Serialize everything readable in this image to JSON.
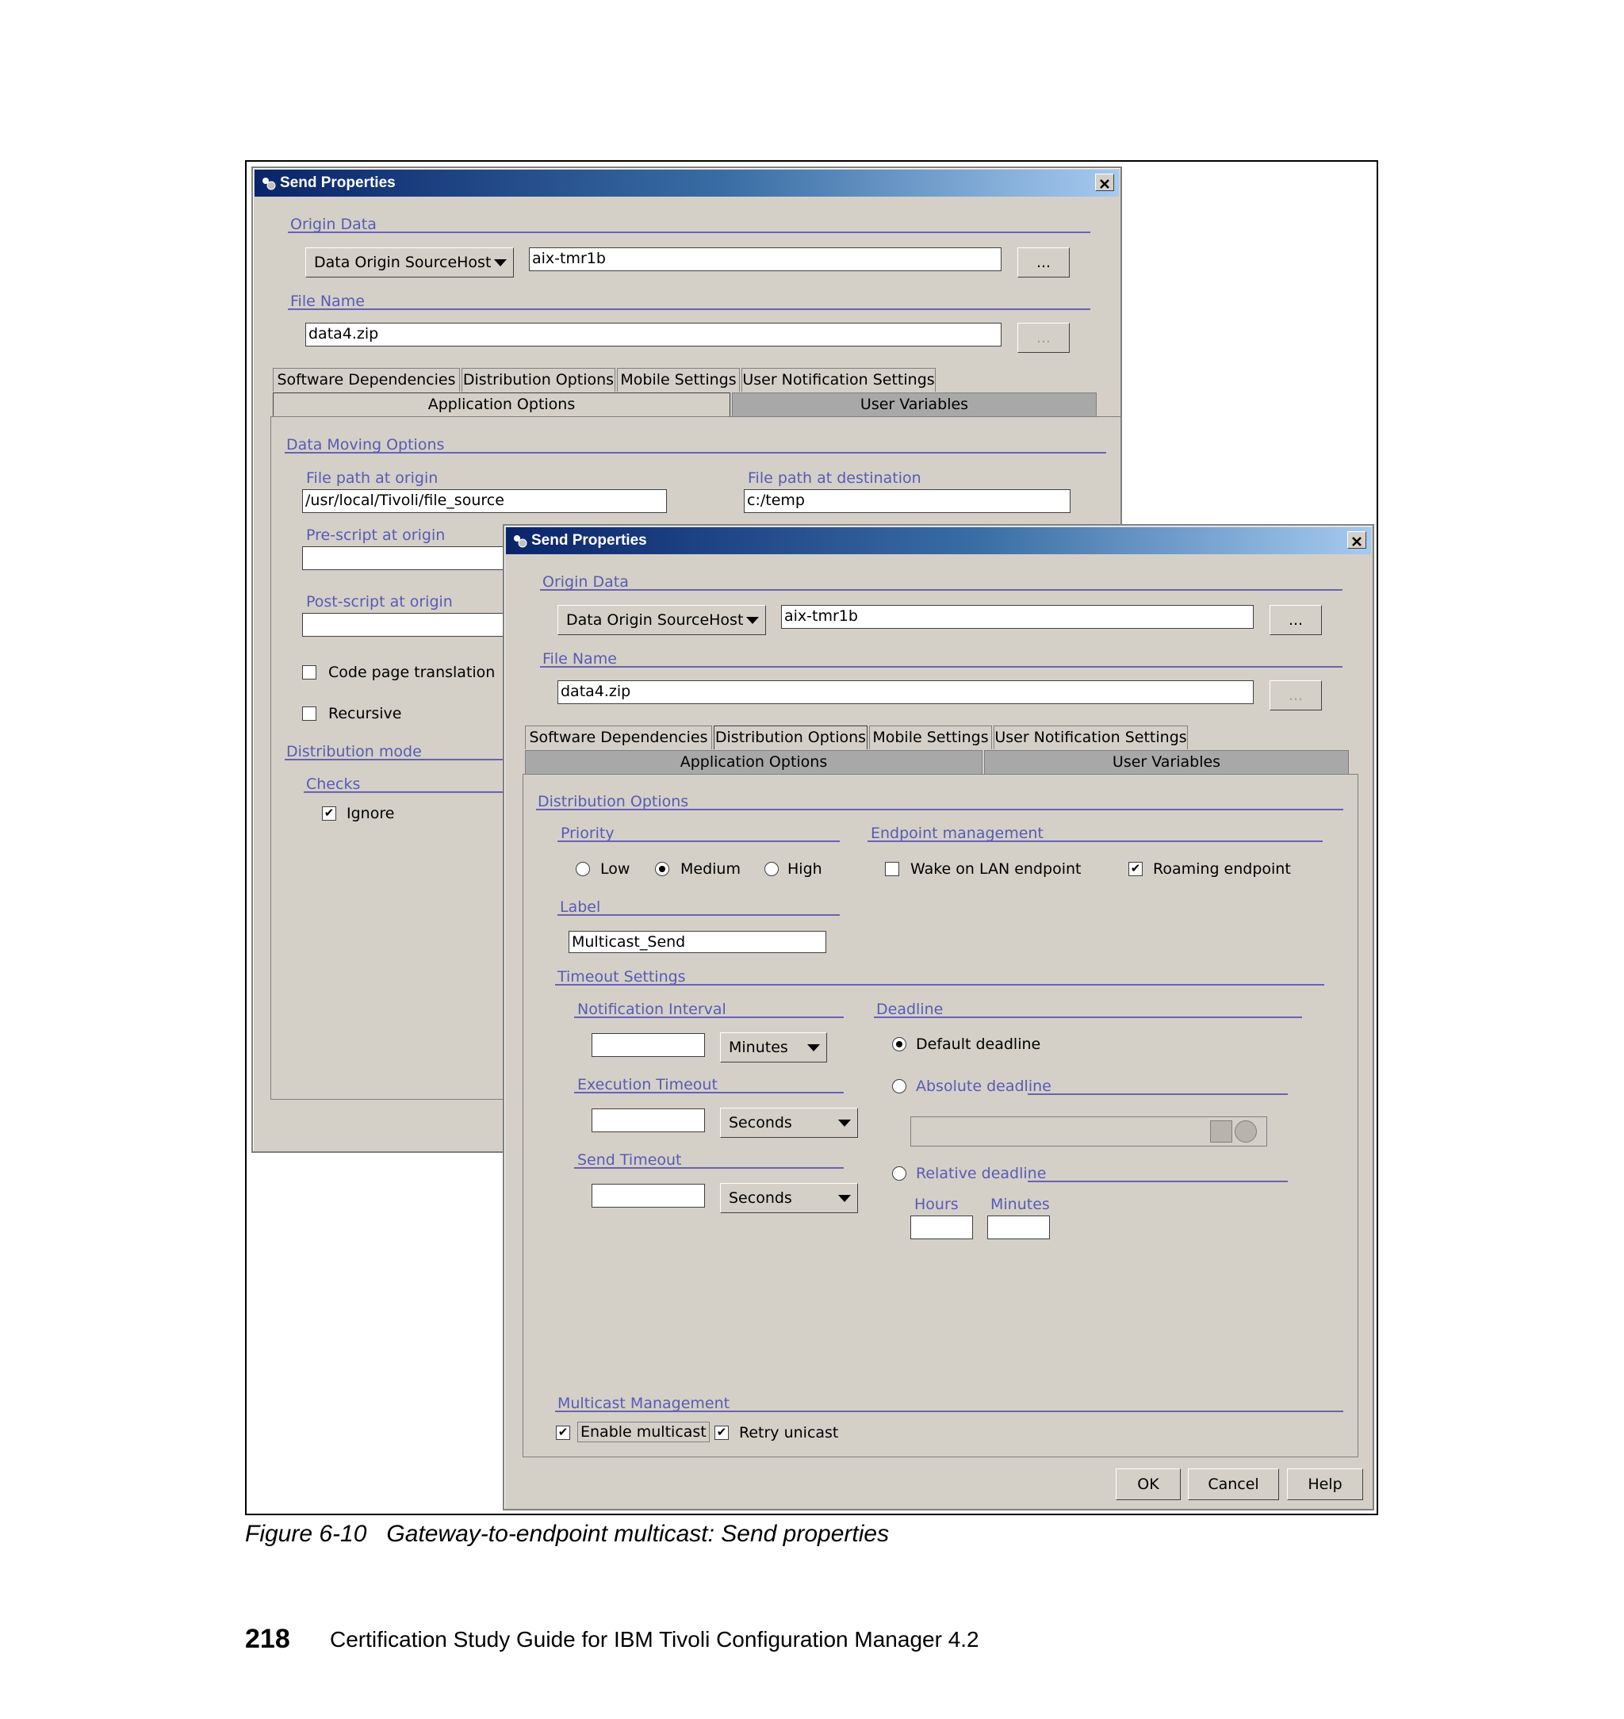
{
  "back_window": {
    "title": "Send Properties",
    "origin_data_label": "Origin Data",
    "origin_combo": "Data Origin SourceHost",
    "origin_value": "aix-tmr1b",
    "browse_label": "...",
    "file_name_label": "File Name",
    "file_name_value": "data4.zip",
    "tabs_row1": [
      "Software Dependencies",
      "Distribution Options",
      "Mobile Settings",
      "User Notification Settings"
    ],
    "tabs_row2": [
      "Application Options",
      "User Variables"
    ],
    "data_moving_options": "Data Moving Options",
    "file_path_origin_label": "File path at origin",
    "file_path_origin_value": "/usr/local/Tivoli/file_source",
    "file_path_dest_label": "File path at destination",
    "file_path_dest_value": "c:/temp",
    "prescript_label": "Pre-script at origin",
    "postscript_label": "Post-script at origin",
    "code_page_label": "Code page translation",
    "recursive_label": "Recursive",
    "distribution_mode_label": "Distribution mode",
    "checks_label": "Checks",
    "ignore_label": "Ignore"
  },
  "front_window": {
    "title": "Send Properties",
    "origin_data_label": "Origin Data",
    "origin_combo": "Data Origin SourceHost",
    "origin_value": "aix-tmr1b",
    "browse_label": "...",
    "file_name_label": "File Name",
    "file_name_value": "data4.zip",
    "tabs_row1": [
      "Software Dependencies",
      "Distribution Options",
      "Mobile Settings",
      "User Notification Settings"
    ],
    "tabs_row2": [
      "Application Options",
      "User Variables"
    ],
    "distribution_options_label": "Distribution Options",
    "priority_label": "Priority",
    "priority_low": "Low",
    "priority_medium": "Medium",
    "priority_high": "High",
    "priority_selected": "Medium",
    "endpoint_mgmt_label": "Endpoint management",
    "wake_on_lan_label": "Wake on LAN endpoint",
    "roaming_label": "Roaming endpoint",
    "label_label": "Label",
    "label_value": "Multicast_Send",
    "timeout_settings_label": "Timeout Settings",
    "notification_interval_label": "Notification Interval",
    "notification_unit": "Minutes",
    "execution_timeout_label": "Execution Timeout",
    "execution_unit": "Seconds",
    "send_timeout_label": "Send Timeout",
    "send_unit": "Seconds",
    "deadline_label": "Deadline",
    "default_deadline_label": "Default deadline",
    "absolute_deadline_label": "Absolute deadline",
    "relative_deadline_label": "Relative deadline",
    "hours_label": "Hours",
    "minutes_label": "Minutes",
    "multicast_mgmt_label": "Multicast Management",
    "enable_multicast_label": "Enable multicast",
    "retry_unicast_label": "Retry unicast",
    "ok_label": "OK",
    "cancel_label": "Cancel",
    "help_label": "Help"
  },
  "checks": {
    "ignore": "✔",
    "roaming": "✔",
    "enable_multicast": "✔",
    "retry_unicast": "✔"
  },
  "caption": "Figure 6-10   Gateway-to-endpoint multicast: Send properties",
  "page_number": "218",
  "footer_text": "Certification Study Guide for IBM Tivoli Configuration Manager 4.2"
}
